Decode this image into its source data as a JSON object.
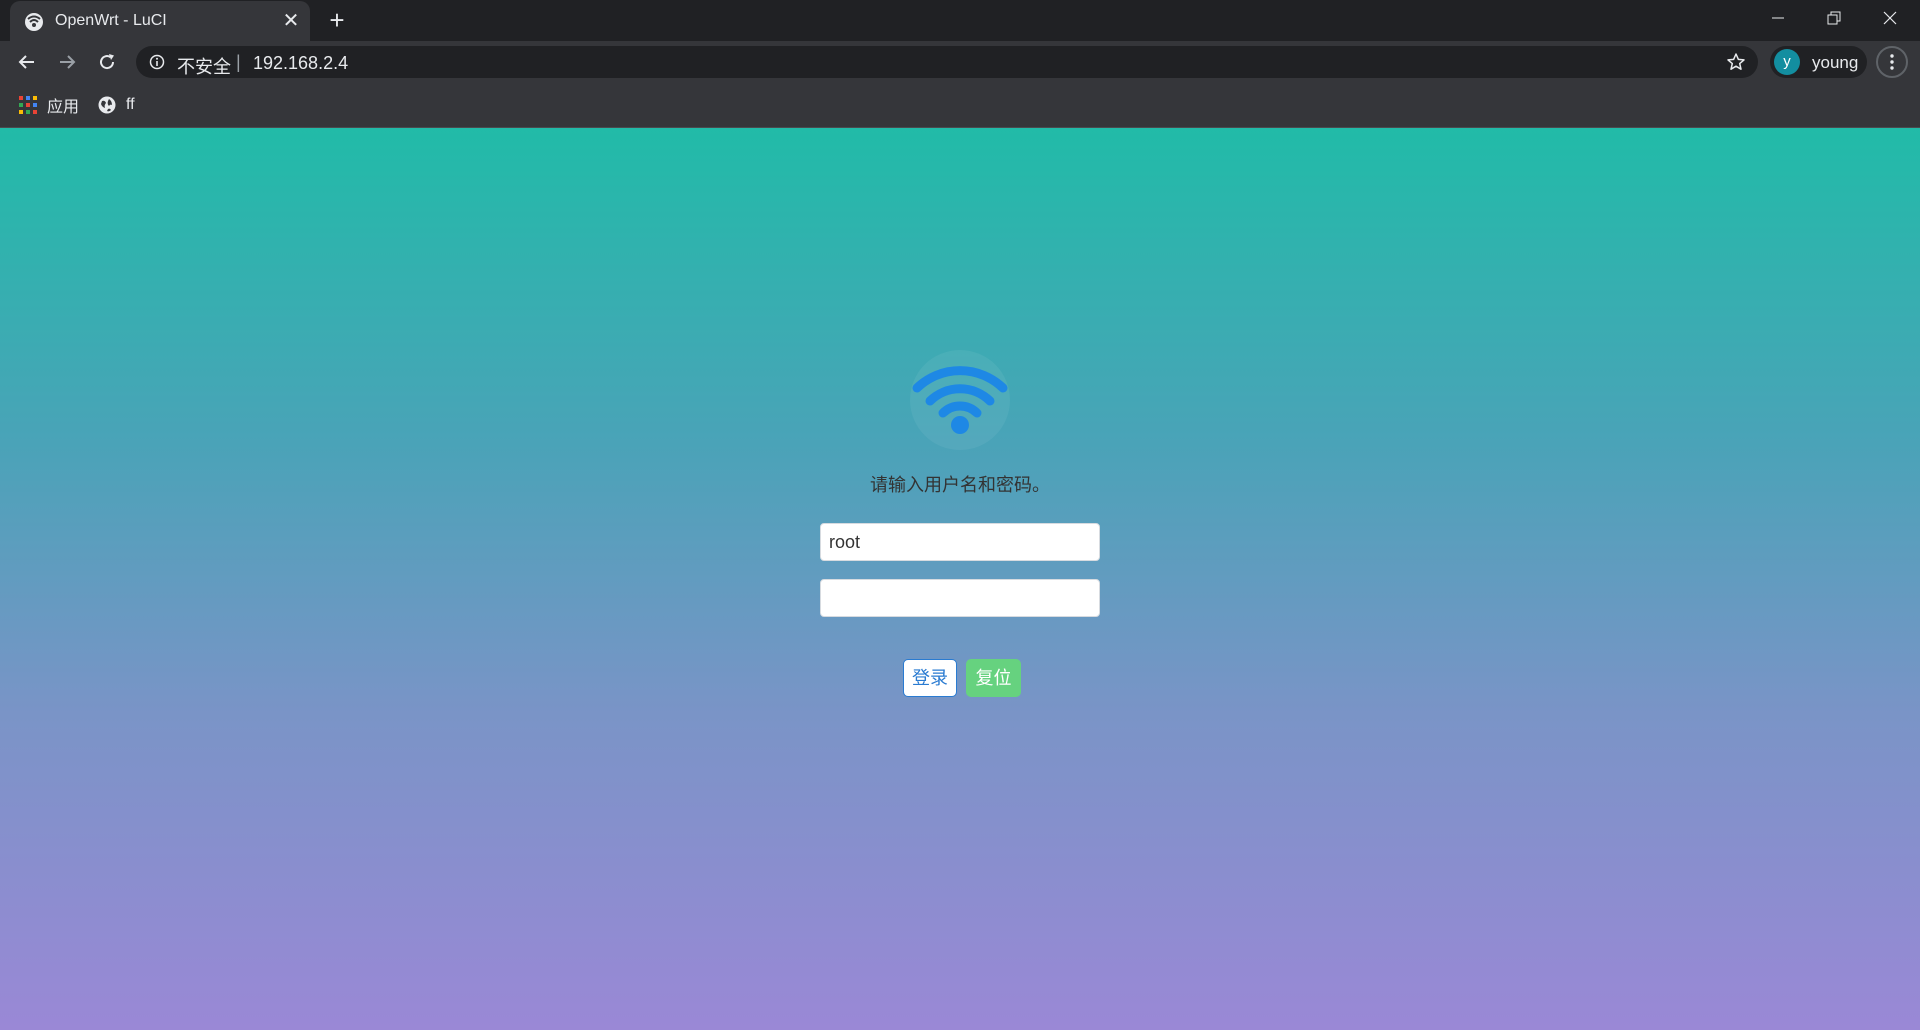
{
  "browser": {
    "tab": {
      "title": "OpenWrt - LuCI",
      "close_glyph": "✕"
    },
    "new_tab_glyph": "+",
    "address_bar": {
      "security_label": "不安全",
      "separator": "|",
      "url": "192.168.2.4"
    },
    "profile": {
      "initial": "y",
      "name": "young"
    },
    "bookmarks": [
      {
        "label": "应用",
        "icon": "apps-grid-icon"
      },
      {
        "label": "ff",
        "icon": "globe-icon"
      }
    ]
  },
  "login": {
    "logo_icon": "wifi-icon",
    "logo_color": "#1e88e5",
    "prompt": "请输入用户名和密码。",
    "username": {
      "value": "root",
      "placeholder": ""
    },
    "password": {
      "value": "",
      "placeholder": ""
    },
    "login_button": "登录",
    "reset_button": "复位"
  },
  "colors": {
    "gradient_top": "#21bba8",
    "gradient_bottom": "#9a88d6",
    "login_accent": "#2a7bd1",
    "reset_accent": "#66d27f"
  }
}
